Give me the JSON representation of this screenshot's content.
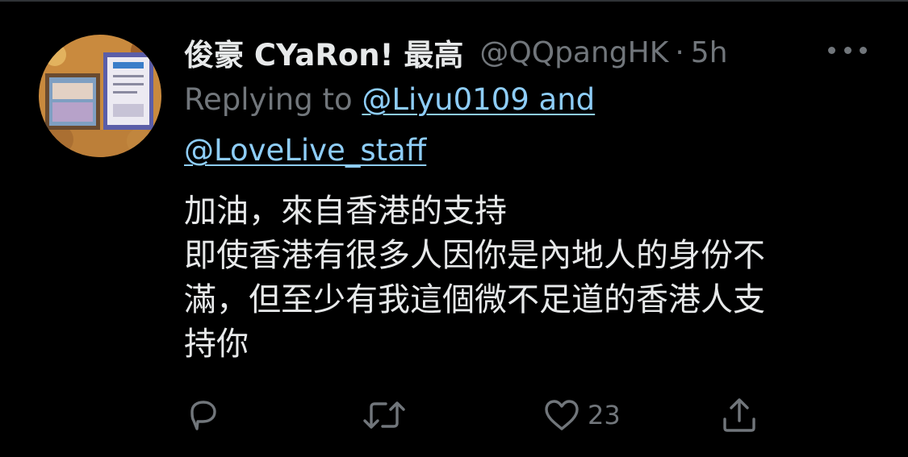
{
  "tweet": {
    "display_name": "俊豪 CYaRon! 最高",
    "handle": "@QQpangHK",
    "separator": "·",
    "time": "5h",
    "replying_prefix": "Replying to",
    "mention_1": "@Liyu0109 and",
    "mention_2": "@LoveLive_staff",
    "text_lines": [
      "加油，來自香港的支持",
      "即使香港有很多人因你是內地人的身份不",
      "滿，但至少有我這個微不足道的香港人支",
      "持你"
    ],
    "likes": "23"
  },
  "icons": {
    "more": "more-horizontal-icon",
    "reply": "reply-bubble-icon",
    "retweet": "retweet-icon",
    "like": "heart-icon",
    "share": "share-icon"
  },
  "colors": {
    "background": "#000000",
    "name": "#e7e9ea",
    "secondary": "#71767b",
    "link": "#8ecdf8"
  }
}
